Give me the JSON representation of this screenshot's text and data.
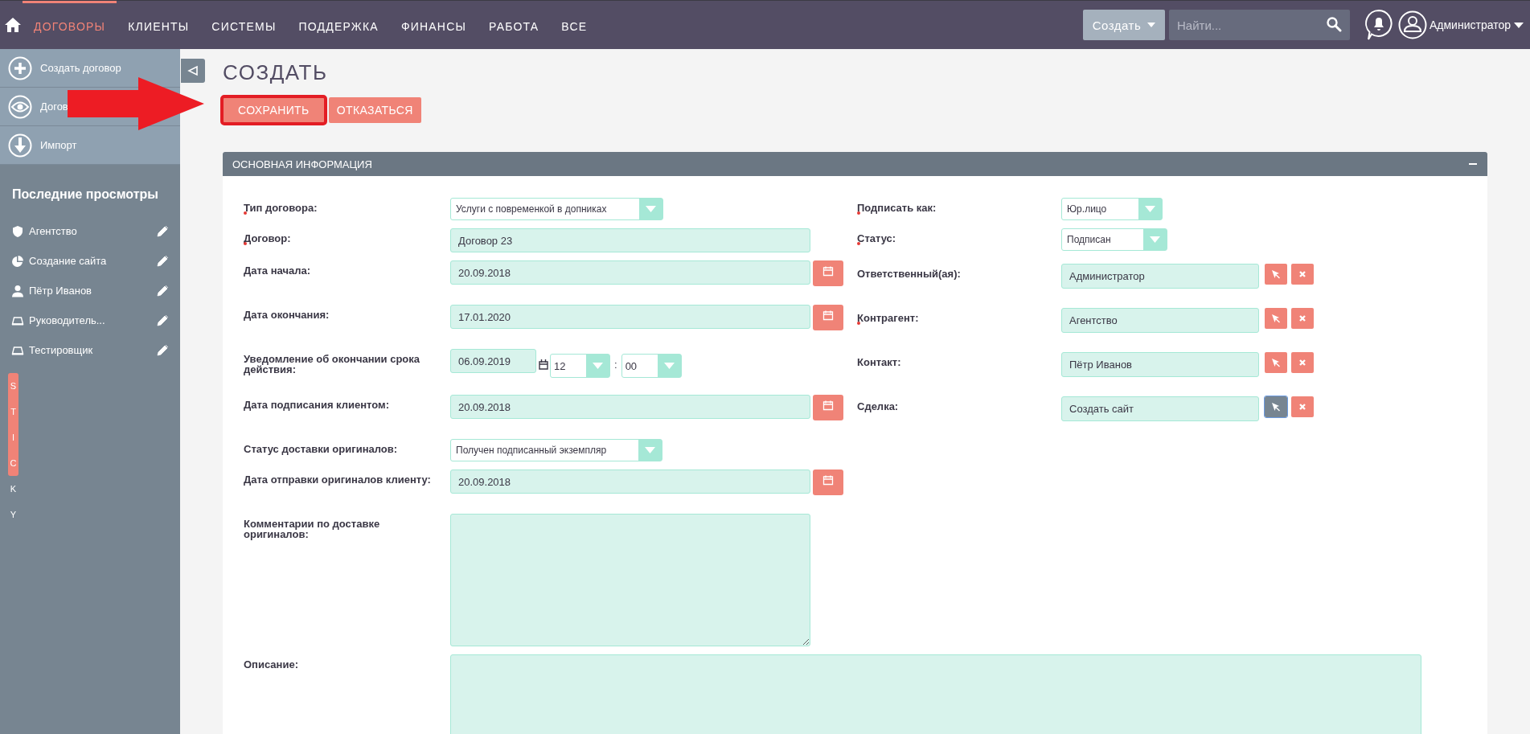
{
  "nav": {
    "items": [
      {
        "label": "ДОГОВОРЫ",
        "selected": true
      },
      {
        "label": "КЛИЕНТЫ",
        "selected": false
      },
      {
        "label": "СИСТЕМЫ",
        "selected": false
      },
      {
        "label": "ПОДДЕРЖКА",
        "selected": false
      },
      {
        "label": "ФИНАНСЫ",
        "selected": false
      },
      {
        "label": "РАБОТА",
        "selected": false
      },
      {
        "label": "ВСЕ",
        "selected": false
      }
    ],
    "create_button": "Создать",
    "search": {
      "placeholder": "Найти..."
    },
    "user": "Администратор"
  },
  "sidebar": {
    "actions": [
      {
        "kind": "create",
        "label": "Создать договор"
      },
      {
        "kind": "view",
        "label": "Догов"
      },
      {
        "kind": "import",
        "label": "Импорт"
      }
    ],
    "recent": {
      "title": "Последние просмотры",
      "items": [
        {
          "kind": "account",
          "label": "Агентство"
        },
        {
          "kind": "opportunity",
          "label": "Создание сайта"
        },
        {
          "kind": "contact",
          "label": "Пётр Иванов"
        },
        {
          "kind": "project",
          "label": "Руководитель..."
        },
        {
          "kind": "project",
          "label": "Тестировщик"
        }
      ]
    },
    "sticky_letters": [
      {
        "letter": "S",
        "highlighted": true
      },
      {
        "letter": "T",
        "highlighted": true
      },
      {
        "letter": "I",
        "highlighted": true
      },
      {
        "letter": "C",
        "highlighted": true
      },
      {
        "letter": "K",
        "highlighted": false
      },
      {
        "letter": "Y",
        "highlighted": false
      }
    ]
  },
  "page": {
    "title": "СОЗДАТЬ",
    "buttons": [
      {
        "kind": "save",
        "label": "СОХРАНИТЬ",
        "highlighted": true
      },
      {
        "kind": "cancel",
        "label": "ОТКАЗАТЬСЯ",
        "highlighted": false
      }
    ]
  },
  "panel": {
    "title": "ОСНОВНАЯ ИНФОРМАЦИЯ",
    "expanded": true,
    "left_fields": [
      {
        "kind": "select",
        "label": "Тип договора:",
        "required": true,
        "value": "Услуги с повременкой в допниках"
      },
      {
        "kind": "text",
        "label": "Договор:",
        "required": true,
        "value": "Договор 23"
      },
      {
        "kind": "date",
        "label": "Дата начала:",
        "required": false,
        "value": "20.09.2018"
      },
      {
        "kind": "date",
        "label": "Дата окончания:",
        "required": false,
        "value": "17.01.2020"
      },
      {
        "kind": "datetime",
        "label": "Уведомление об окончании срока действия:",
        "required": false,
        "date": "06.09.2019",
        "hour": "12",
        "separator": ":",
        "minute": "00"
      },
      {
        "kind": "date",
        "label": "Дата подписания клиентом:",
        "required": false,
        "value": "20.09.2018"
      },
      {
        "kind": "select",
        "label": "Статус доставки оригиналов:",
        "required": false,
        "value": "Получен подписанный экземпляр"
      },
      {
        "kind": "date",
        "label": "Дата отправки оригиналов клиенту:",
        "required": false,
        "value": "20.09.2018"
      },
      {
        "kind": "textarea",
        "label": "Комментарии по доставке оригиналов:",
        "required": false
      }
    ],
    "right_fields": [
      {
        "kind": "select",
        "label": "Подписать как:",
        "required": true,
        "value": "Юр.лицо"
      },
      {
        "kind": "select",
        "label": "Статус:",
        "required": true,
        "value": "Подписан"
      },
      {
        "kind": "relate",
        "label": "Ответственный(ая):",
        "required": false,
        "value": "Администратор",
        "focused": false
      },
      {
        "kind": "relate",
        "label": "Контрагент:",
        "required": true,
        "value": "Агентство",
        "focused": false
      },
      {
        "kind": "relate",
        "label": "Контакт:",
        "required": false,
        "value": "Пётр Иванов",
        "focused": false
      },
      {
        "kind": "relate",
        "label": "Сделка:",
        "required": false,
        "value": "Создать сайт",
        "focused": true
      }
    ],
    "description": {
      "label": "Описание:"
    }
  }
}
